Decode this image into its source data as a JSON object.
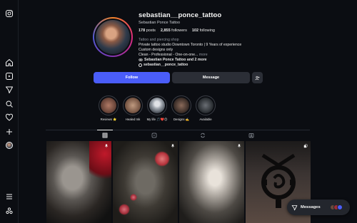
{
  "profile": {
    "username": "sebastian__ponce_tattoo",
    "more_icon": "ellipsis-icon",
    "full_name": "Sebastian Ponce Tattoo",
    "stats": {
      "posts_count": "178",
      "posts_label": "posts",
      "followers_count": "2,855",
      "followers_label": "followers",
      "following_count": "102",
      "following_label": "following"
    },
    "category": "Tattoo and piercing shop",
    "bio_lines": [
      "Private tattoo studio Downtown Toronto | 9 Years of experience",
      "Custom designs only",
      "Clean - Professional - One-on-one..."
    ],
    "bio_more": "more",
    "followed_by": "Sebastian Ponce Tattoo and 2 more",
    "threads_handle": "sebastian__ponce_tattoo"
  },
  "actions": {
    "follow_label": "Follow",
    "message_label": "Message",
    "suggest_icon": "add-person-icon"
  },
  "highlights": [
    {
      "label": "Reviews ⭐️",
      "colors": [
        "#b07a66",
        "#5a3a30"
      ]
    },
    {
      "label": "Healed Ink",
      "colors": [
        "#c09a80",
        "#6a4a3a"
      ]
    },
    {
      "label": "My life 🎵❤️😊",
      "colors": [
        "#9aa0a8",
        "#3a4048"
      ]
    },
    {
      "label": "Designs ✍️",
      "colors": [
        "#8a6a5a",
        "#2e2420"
      ]
    },
    {
      "label": "Available",
      "colors": [
        "#6a6e74",
        "#202428"
      ]
    }
  ],
  "tabs": [
    {
      "name": "posts",
      "icon": "grid-icon",
      "active": true
    },
    {
      "name": "reels",
      "icon": "reels-icon",
      "active": false
    },
    {
      "name": "reposts",
      "icon": "repost-icon",
      "active": false
    },
    {
      "name": "tagged",
      "icon": "tagged-icon",
      "active": false
    }
  ],
  "sidebar": {
    "items": [
      "instagram-logo-icon",
      "home-icon",
      "reels-icon",
      "direct-icon",
      "search-icon",
      "notifications-icon",
      "create-icon",
      "profile-avatar",
      "menu-icon",
      "meta-apps-icon"
    ]
  },
  "messages_pill": {
    "label": "Messages",
    "icon": "send-icon"
  },
  "colors": {
    "background": "#0b0d12",
    "follow_button": "#4a5df9",
    "secondary_button": "#2b2e36",
    "muted_text": "#8e939c"
  }
}
